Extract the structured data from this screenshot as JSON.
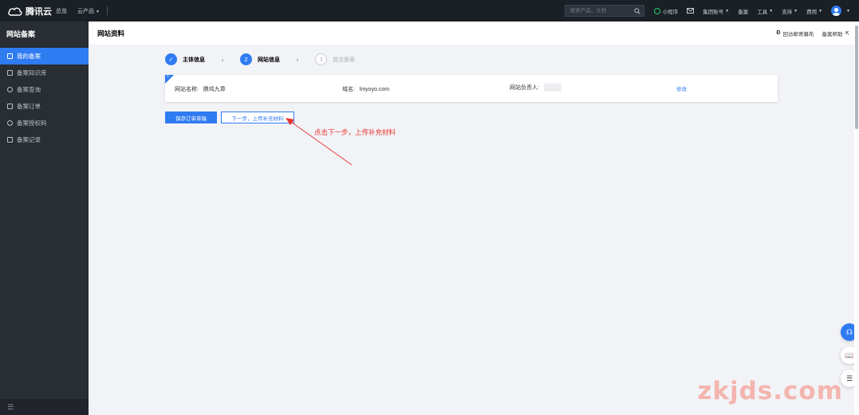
{
  "topbar": {
    "brand": "腾讯云",
    "nav": [
      {
        "label": "总览"
      },
      {
        "label": "云产品",
        "caret": true
      }
    ],
    "search_placeholder": "搜索产品、文档",
    "right_items": [
      {
        "label": "小程序"
      },
      {
        "label": "集团账号",
        "caret": true
      },
      {
        "label": "备案"
      },
      {
        "label": "工具",
        "caret": true
      },
      {
        "label": "支持",
        "caret": true
      },
      {
        "label": "费用",
        "caret": true
      }
    ]
  },
  "sidebar": {
    "title": "网站备案",
    "items": [
      {
        "label": "我的备案",
        "active": true
      },
      {
        "label": "备案知识库"
      },
      {
        "label": "备案查询"
      },
      {
        "label": "备案订单"
      },
      {
        "label": "备案授权码"
      },
      {
        "label": "备案记录"
      }
    ],
    "footer_icon": "collapse-icon"
  },
  "page": {
    "title": "网站资料",
    "links": [
      {
        "label": "回访邮寄幕布"
      },
      {
        "label": "备案帮助"
      }
    ]
  },
  "steps": [
    {
      "num": "",
      "label": "主体信息",
      "state": "done"
    },
    {
      "num": "2",
      "label": "网站信息",
      "state": "current"
    },
    {
      "num": "3",
      "label": "提交备案",
      "state": "todo"
    }
  ],
  "site_card": {
    "index": "1",
    "name_label": "网站名称:",
    "name_value": "鼎鸡九章",
    "domain_label": "域名:",
    "domain_value": "lmyoyo.com",
    "owner_label": "网站负责人:",
    "edit_label": "修改"
  },
  "buttons": {
    "save": "保存订单草稿",
    "next": "下一步，上传补充材料"
  },
  "annotation": "点击下一步，上传补充材料",
  "watermark": "zkjds.com",
  "colors": {
    "accent": "#2f7bf2",
    "topbar_bg": "#1b2026",
    "sidebar_bg": "#292d34",
    "annotation": "#e8342f"
  }
}
